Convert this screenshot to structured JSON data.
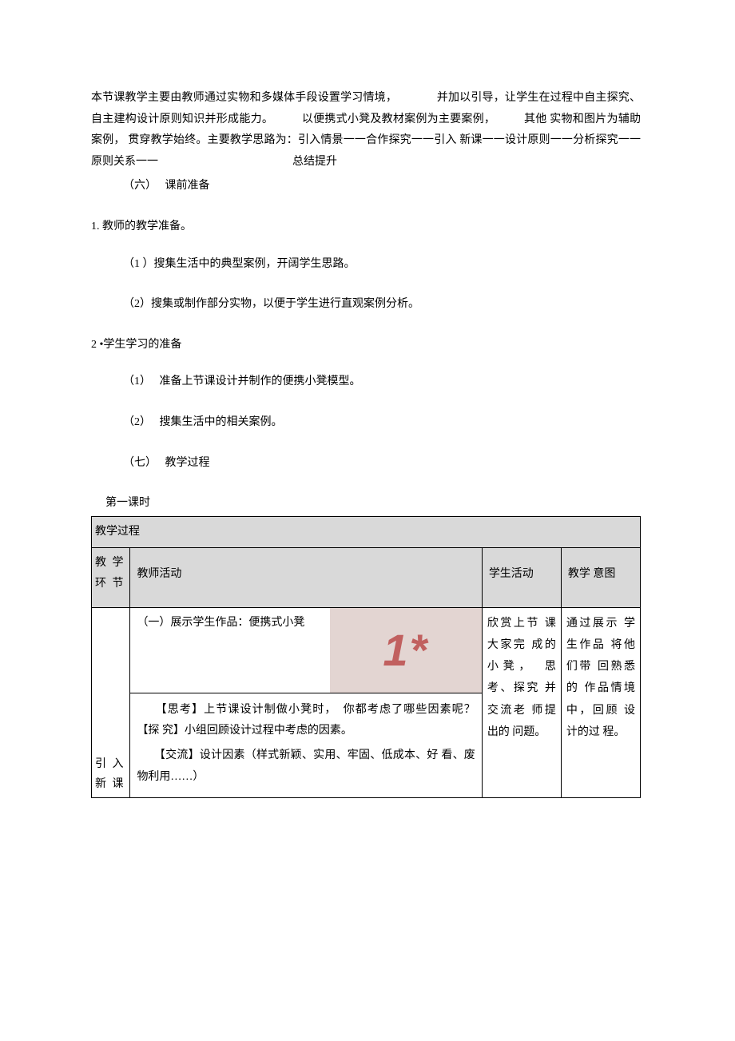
{
  "intro": {
    "p1": "本节课教学主要由教师通过实物和多媒体手段设置学习情境，　　　　并加以引导，让学生在过程中自主探究、自主建构设计原则知识并形成能力。　　　以便携式小凳及教材案例为主要案例，　　　其他 实物和图片为辅助案例， 贯穿教学始终。主要教学思路为：引入情景一一合作探究一一引入 新课一一设计原则一一分析探究一一原则关系一一　　　　　　　　　　　　总结提升",
    "p2": "（六）　 课前准备"
  },
  "sections": {
    "s1": "1. 教师的教学准备。",
    "s1_1": "（1 ）搜集生活中的典型案例，开阔学生思路。",
    "s1_2": "（2）搜集或制作部分实物，以便于学生进行直观案例分析。",
    "s2": "2 •学生学习的准备",
    "s2_1": "（1）　 准备上节课设计并制作的便携小凳模型。",
    "s2_2": "（2）　 搜集生活中的相关案例。",
    "s3": "（七）　 教学过程"
  },
  "caption": "第一课时",
  "table": {
    "header_row": "教学过程",
    "col1": "教 学 环 节",
    "col2": "教师活动",
    "col3": "学生活动",
    "col4": "教学 意图",
    "row_env": "引 入 新 课",
    "row_t1": "（一）展示学生作品：便携式小凳",
    "wm": "1*",
    "row_t2": "　　【思考】上节课设计制做小凳时，　你都考虑了哪些因素呢？　【探 究】小组回顾设计过程中考虑的因素。",
    "row_t3": "　　【交流】设计因素（样式新颖、实用、牢固、低成本、好 看、废物利用……）",
    "row_student": "欣赏上节 课大家完 成的小凳，　思考、探究 并交流老 师提出的 问题。",
    "row_intent": "通过展示 学生作品 将他们带 回熟悉的 作品情境中，回顾 设计的过 程。"
  }
}
